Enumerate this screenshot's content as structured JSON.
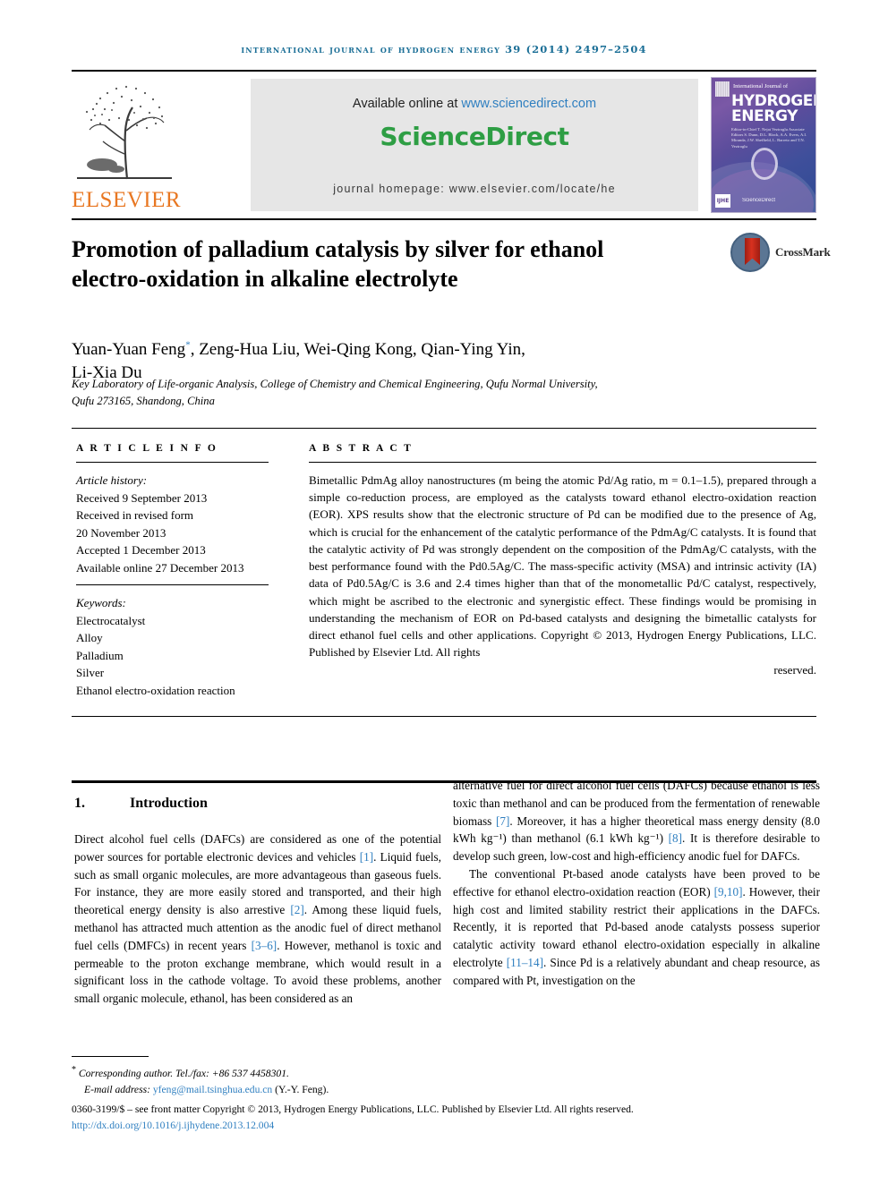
{
  "running_head": "International Journal of Hydrogen Energy 39 (2014) 2497–2504",
  "masthead": {
    "publisher_name": "ELSEVIER",
    "available_prefix": "Available online at ",
    "available_url": "www.sciencedirect.com",
    "sciencedirect_logo": "ScienceDirect",
    "homepage": "journal homepage: www.elsevier.com/locate/he",
    "cover": {
      "line_small": "International Journal of",
      "line1": "HYDROGEN",
      "line2": "ENERGY",
      "editors": "Editor-in-Chief  T. Nejat Veziroglu\nAssociate Editors  S. Dunn, D.L. Block, A.A. Evers, A.I. Miranda, J.W. Sheffield, L. Barreto and T.N. Veziroglu",
      "badge": "IJHE",
      "sd_mark": "ScienceDirect"
    }
  },
  "article": {
    "title": "Promotion of palladium catalysis by silver for ethanol electro-oxidation in alkaline electrolyte",
    "crossmark_label": "CrossMark",
    "authors": "Yuan-Yuan Feng*, Zeng-Hua Liu, Wei-Qing Kong, Qian-Ying Yin, Li-Xia Du",
    "authors_line1": "Yuan-Yuan Feng",
    "authors_line1_rest": ", Zeng-Hua Liu, Wei-Qing Kong, Qian-Ying Yin,",
    "authors_line2": "Li-Xia Du",
    "author_star": "*",
    "affiliation_line1": "Key Laboratory of Life-organic Analysis, College of Chemistry and Chemical Engineering, Qufu Normal University,",
    "affiliation_line2": "Qufu 273165, Shandong, China"
  },
  "article_info": {
    "label": "A R T I C L E   I N F O",
    "history_label": "Article history:",
    "history": [
      "Received 9 September 2013",
      "Received in revised form",
      "20 November 2013",
      "Accepted 1 December 2013",
      "Available online 27 December 2013"
    ],
    "keywords_label": "Keywords:",
    "keywords": [
      "Electrocatalyst",
      "Alloy",
      "Palladium",
      "Silver",
      "Ethanol electro-oxidation reaction"
    ]
  },
  "abstract": {
    "label": "A B S T R A C T",
    "body": "Bimetallic PdmAg alloy nanostructures (m being the atomic Pd/Ag ratio, m = 0.1–1.5), prepared through a simple co-reduction process, are employed as the catalysts toward ethanol electro-oxidation reaction (EOR). XPS results show that the electronic structure of Pd can be modified due to the presence of Ag, which is crucial for the enhancement of the catalytic performance of the PdmAg/C catalysts. It is found that the catalytic activity of Pd was strongly dependent on the composition of the PdmAg/C catalysts, with the best performance found with the Pd0.5Ag/C. The mass-specific activity (MSA) and intrinsic activity (IA) data of Pd0.5Ag/C is 3.6 and 2.4 times higher than that of the monometallic Pd/C catalyst, respectively, which might be ascribed to the electronic and synergistic effect. These findings would be promising in understanding the mechanism of EOR on Pd-based catalysts and designing the bimetallic catalysts for direct ethanol fuel cells and other applications.",
    "copyright": "Copyright © 2013, Hydrogen Energy Publications, LLC. Published by Elsevier Ltd. All rights",
    "copyright_tail": "reserved."
  },
  "introduction": {
    "number": "1.",
    "title": "Introduction",
    "left_p1_a": "Direct alcohol fuel cells (DAFCs) are considered as one of the potential power sources for portable electronic devices and vehicles ",
    "left_c1": "[1]",
    "left_p1_b": ". Liquid fuels, such as small organic molecules, are more advantageous than gaseous fuels. For instance, they are more easily stored and transported, and their high theoretical energy density is also arrestive ",
    "left_c2": "[2]",
    "left_p1_c": ". Among these liquid fuels, methanol has attracted much attention as the anodic fuel of direct methanol fuel cells (DMFCs) in recent years ",
    "left_c3": "[3–6]",
    "left_p1_d": ". However, methanol is toxic and permeable to the proton exchange membrane, which would result in a significant loss in the cathode voltage. To avoid these problems, another small organic molecule, ethanol, has been considered as an",
    "right_p1_a": "alternative fuel for direct alcohol fuel cells (DAFCs) because ethanol is less toxic than methanol and can be produced from the fermentation of renewable biomass ",
    "right_c1": "[7]",
    "right_p1_b": ". Moreover, it has a higher theoretical mass energy density (8.0 kWh kg⁻¹) than methanol (6.1 kWh kg⁻¹) ",
    "right_c2": "[8]",
    "right_p1_c": ". It is therefore desirable to develop such green, low-cost and high-efficiency anodic fuel for DAFCs.",
    "right_p2_a": "The conventional Pt-based anode catalysts have been proved to be effective for ethanol electro-oxidation reaction (EOR) ",
    "right_c3": "[9,10]",
    "right_p2_b": ". However, their high cost and limited stability restrict their applications in the DAFCs. Recently, it is reported that Pd-based anode catalysts possess superior catalytic activity toward ethanol electro-oxidation especially in alkaline electrolyte ",
    "right_c4": "[11–14]",
    "right_p2_c": ". Since Pd is a relatively abundant and cheap resource, as compared with Pt, investigation on the"
  },
  "footer": {
    "star": "*",
    "corresponding": "Corresponding author. Tel./fax: +86 537 4458301.",
    "email_label": "E-mail address: ",
    "email": "yfeng@mail.tsinghua.edu.cn",
    "email_suffix": " (Y.-Y. Feng).",
    "issn": "0360-3199/$ – see front matter Copyright © 2013, Hydrogen Energy Publications, LLC. Published by Elsevier Ltd. All rights reserved.",
    "doi": "http://dx.doi.org/10.1016/j.ijhydene.2013.12.004"
  },
  "colors": {
    "link_blue": "#2f7fc0",
    "running_head_blue": "#1a6e96",
    "sciencedirect_green": "#2e9e44",
    "elsevier_orange": "#e87722",
    "crossmark_red": "#d8311f"
  }
}
